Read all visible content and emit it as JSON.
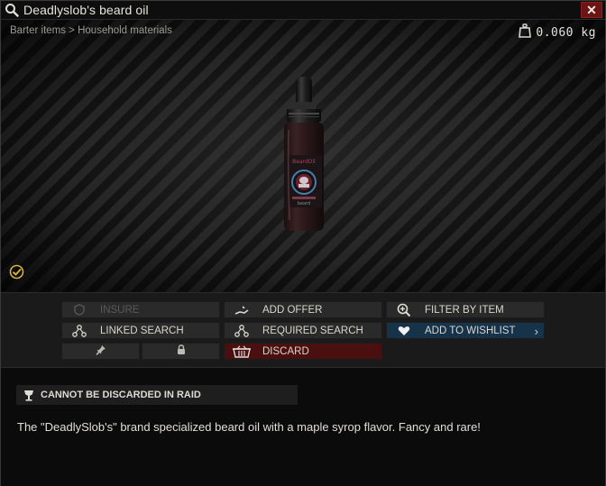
{
  "window": {
    "title": "Deadlyslob's beard oil",
    "close_label": "✕"
  },
  "preview": {
    "breadcrumb": "Barter items > Household materials",
    "weight": "0.060 kg"
  },
  "actions": {
    "insure": "INSURE",
    "add_offer": "ADD OFFER",
    "filter_by_item": "FILTER BY ITEM",
    "linked_search": "LINKED SEARCH",
    "required_search": "REQUIRED SEARCH",
    "add_to_wishlist": "ADD TO WISHLIST",
    "discard": "DISCARD",
    "chevron": "›"
  },
  "info": {
    "restriction": "CANNOT BE DISCARDED IN RAID",
    "description": "The \"DeadlySlob's\" brand specialized beard oil with a maple syrop flavor. Fancy and rare!"
  },
  "colors": {
    "close_button": "#6d1414",
    "wishlist_button": "#16334a",
    "discard_button": "#4a0f0f",
    "examined_check": "#d7b13a"
  },
  "icons": [
    "search-icon",
    "close-icon",
    "weight-icon",
    "examined-check-icon",
    "shield-icon",
    "add-offer-icon",
    "magnifier-plus-icon",
    "linked-search-icon",
    "required-search-icon",
    "heart-icon",
    "pin-icon",
    "lock-icon",
    "discard-icon",
    "no-discard-icon"
  ]
}
